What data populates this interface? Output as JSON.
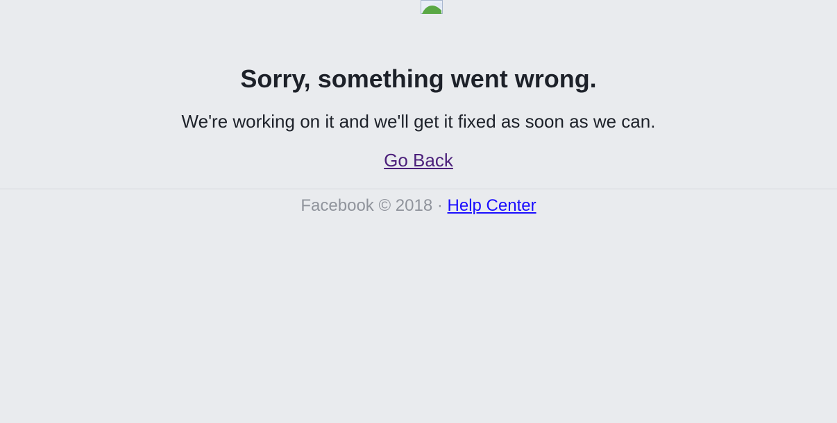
{
  "page": {
    "background": "#e9ebee"
  },
  "header_image": {
    "icon": "broken-image-icon"
  },
  "error": {
    "title": "Sorry, something went wrong.",
    "message": "We're working on it and we'll get it fixed as soon as we can.",
    "go_back_label": "Go Back"
  },
  "footer": {
    "brand_text": "Facebook © 2018",
    "separator": " · ",
    "help_center_label": "Help Center"
  },
  "colors": {
    "text_primary": "#1d2129",
    "text_secondary": "#90949c",
    "visited_link": "#4b1f7a",
    "link": "#1a0dff",
    "divider": "#d3d6db"
  }
}
